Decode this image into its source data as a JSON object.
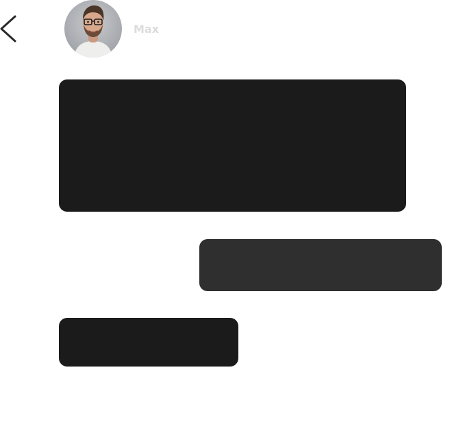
{
  "header": {
    "back_icon": "chevron-left-icon",
    "contact_name": "Max",
    "avatar_alt": "Max"
  },
  "messages": [
    {
      "sender": "contact",
      "text": ""
    },
    {
      "sender": "user",
      "text": ""
    },
    {
      "sender": "contact",
      "text": ""
    }
  ],
  "colors": {
    "background": "#ffffff",
    "back_icon": "#2a2a2a",
    "contact_name": "#dcdcdc",
    "incoming_bubble": "#1b1b1b",
    "outgoing_bubble": "#2f2f2f",
    "bubble_text": "#ffffff"
  }
}
